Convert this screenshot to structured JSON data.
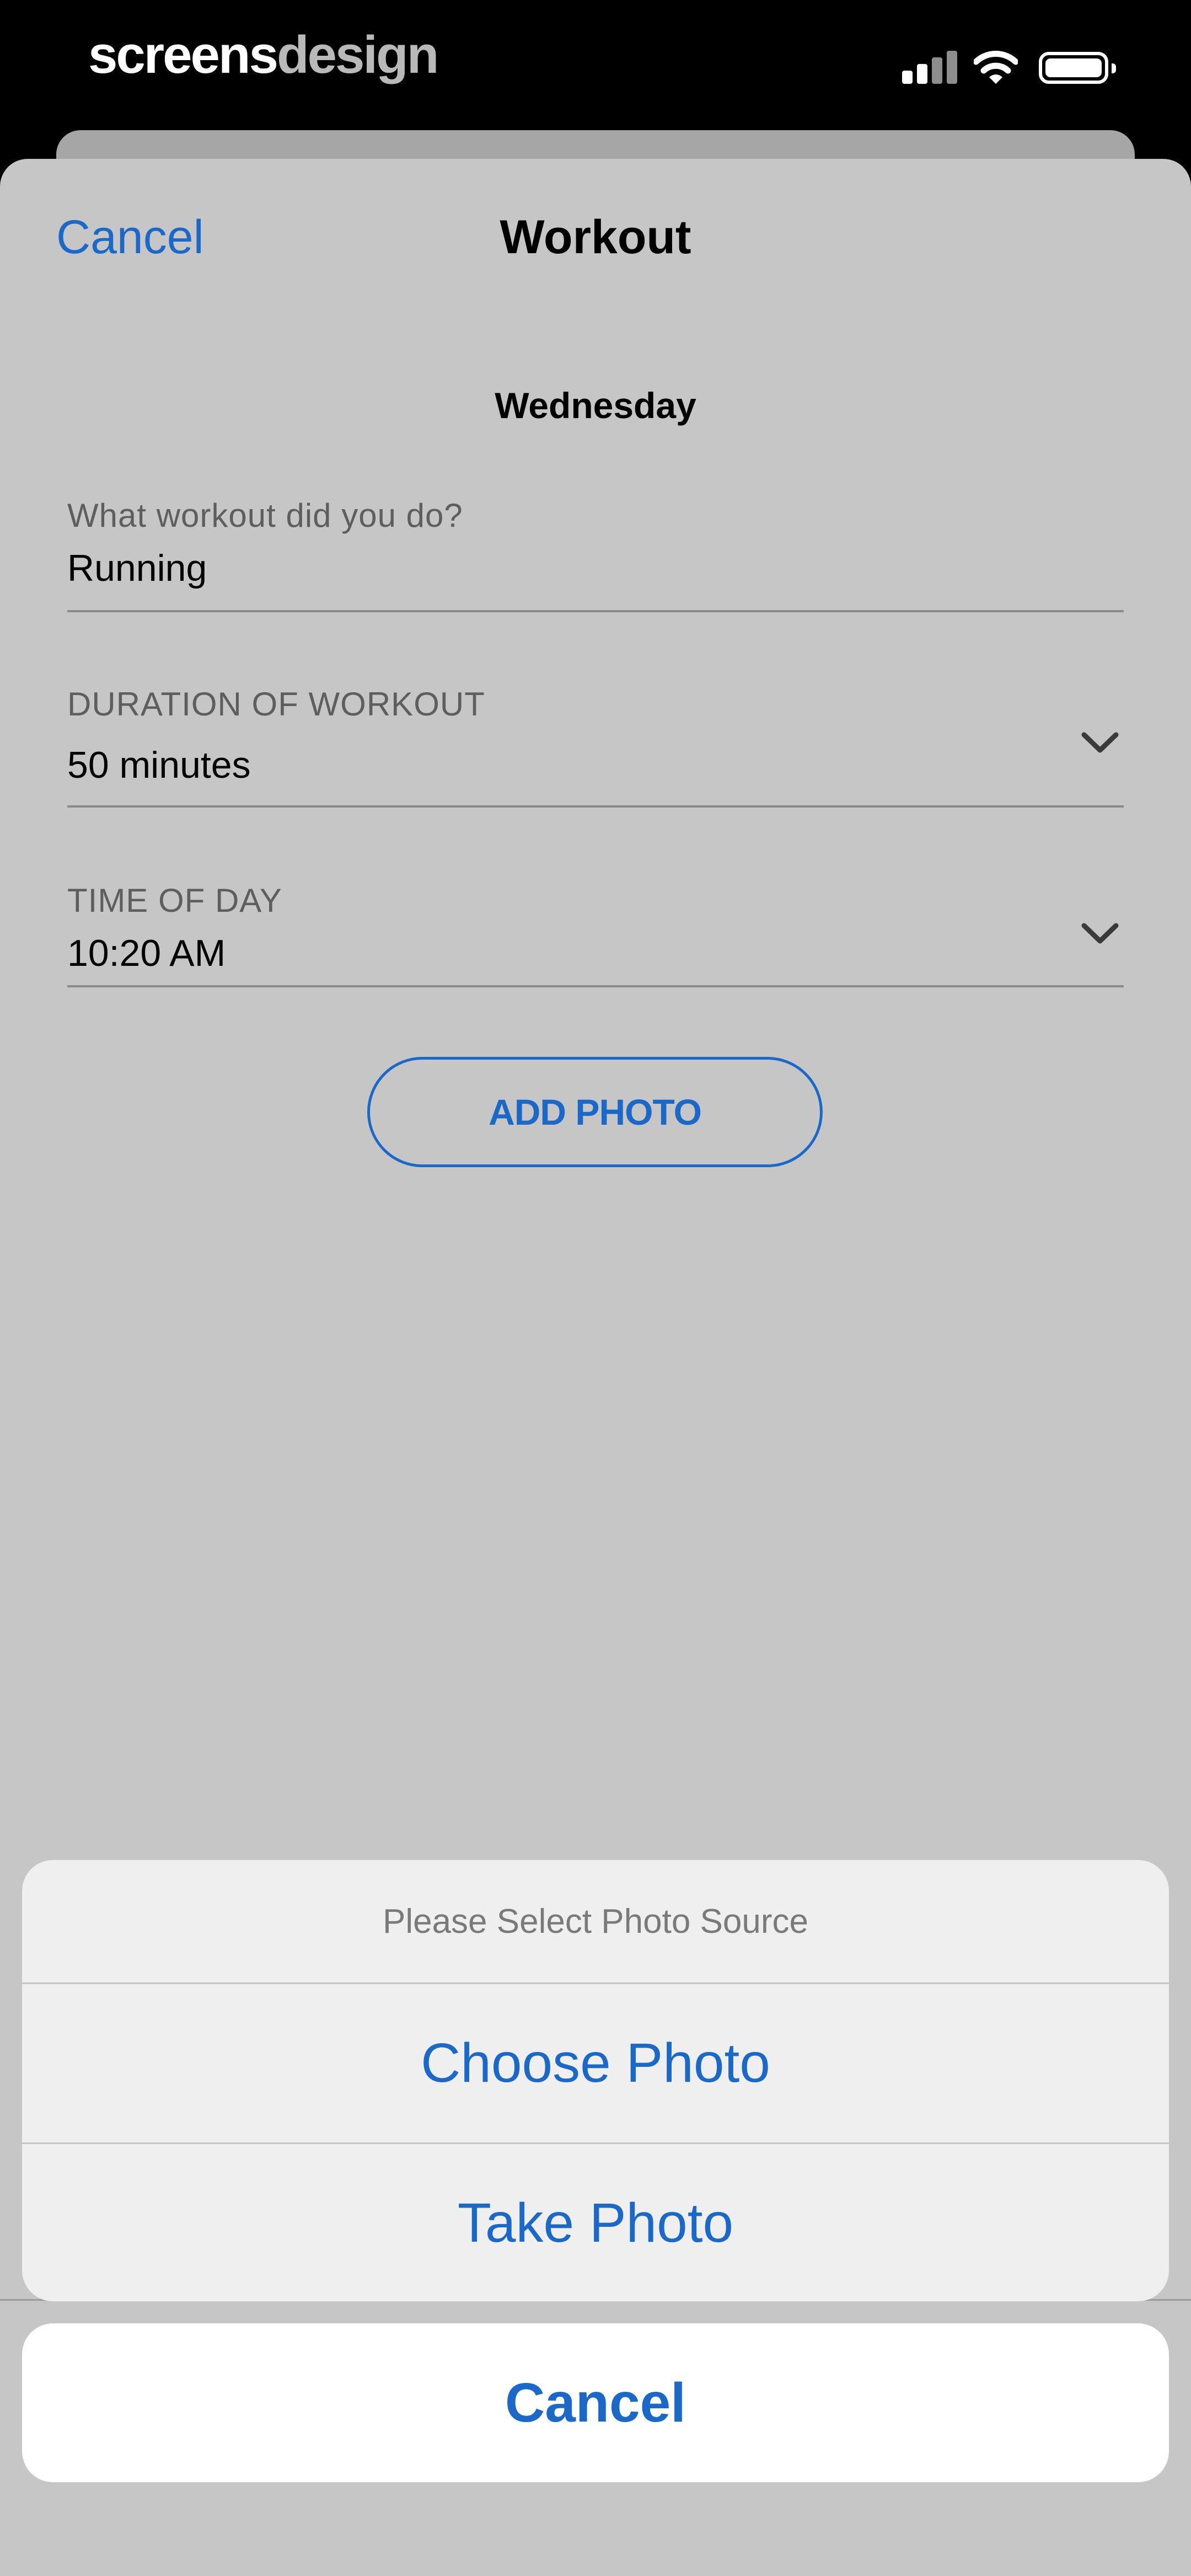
{
  "status_bar": {
    "brand_part1": "screens",
    "brand_part2": "design",
    "icons": [
      "cellular-signal-icon",
      "wifi-icon",
      "battery-icon"
    ]
  },
  "nav": {
    "cancel_label": "Cancel",
    "title": "Workout"
  },
  "day": "Wednesday",
  "fields": {
    "workout": {
      "label": "What workout did you do?",
      "value": "Running"
    },
    "duration": {
      "label": "DURATION OF WORKOUT",
      "value": "50 minutes"
    },
    "time_of_day": {
      "label": "TIME OF DAY",
      "value": "10:20 AM"
    }
  },
  "add_photo_label": "ADD PHOTO",
  "action_sheet": {
    "title": "Please Select Photo Source",
    "options": [
      "Choose Photo",
      "Take Photo"
    ],
    "cancel_label": "Cancel"
  },
  "colors": {
    "accent": "#1a69c9",
    "sheet_background": "#c6c6c6",
    "action_sheet_background": "#efefef"
  }
}
